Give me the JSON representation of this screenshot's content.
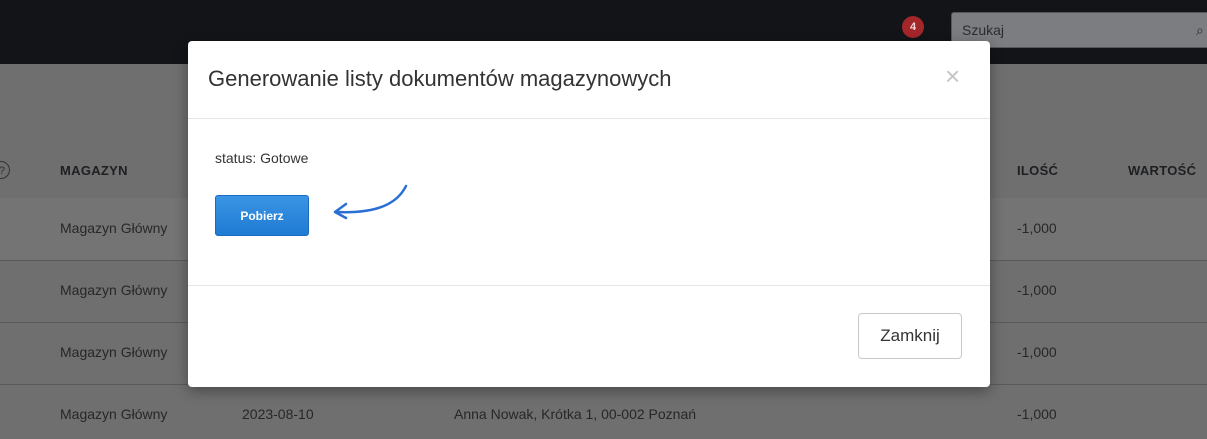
{
  "header": {
    "notification_count": "4",
    "search_placeholder": "Szukaj",
    "search_icon": "search-icon"
  },
  "table": {
    "columns": [
      "MAGAZYN",
      "ILOŚĆ",
      "WARTOŚĆ"
    ],
    "rows": [
      {
        "magazyn": "Magazyn Główny",
        "ilosc": "-1,000"
      },
      {
        "magazyn": "Magazyn Główny",
        "ilosc": "-1,000"
      },
      {
        "magazyn": "Magazyn Główny",
        "ilosc": "-1,000"
      },
      {
        "magazyn": "Magazyn Główny",
        "data": "2023-08-10",
        "kontrahent": "Anna Nowak, Krótka 1, 00-002 Poznań",
        "ilosc": "-1,000"
      }
    ]
  },
  "modal": {
    "title": "Generowanie listy dokumentów magazynowych",
    "close_symbol": "×",
    "status": "status: Gotowe",
    "download_label": "Pobierz",
    "close_label": "Zamknij"
  },
  "colors": {
    "primary_button": "#1f7bd3",
    "annotation_arrow": "#2a6fd6",
    "topbar": "#121418",
    "badge": "#a3262a"
  }
}
